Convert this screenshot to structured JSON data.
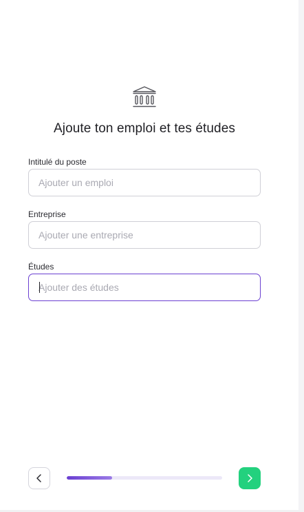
{
  "header": {
    "icon": "institution-icon",
    "title": "Ajoute ton emploi et tes études"
  },
  "form": {
    "job": {
      "label": "Intitulé du poste",
      "value": "",
      "placeholder": "Ajouter un emploi"
    },
    "company": {
      "label": "Entreprise",
      "value": "",
      "placeholder": "Ajouter une entreprise"
    },
    "education": {
      "label": "Études",
      "value": "",
      "placeholder": "Ajouter des études",
      "focused": true
    }
  },
  "navigation": {
    "back_icon": "chevron-left-icon",
    "next_icon": "chevron-right-icon",
    "progress": 0.29
  },
  "colors": {
    "accent": "#6a3fd1",
    "next_button": "#23d17e",
    "progress_track": "#ece8f8",
    "field_border": "#cfcfd6",
    "placeholder": "#a9a9b2",
    "title": "#1f1f24"
  }
}
